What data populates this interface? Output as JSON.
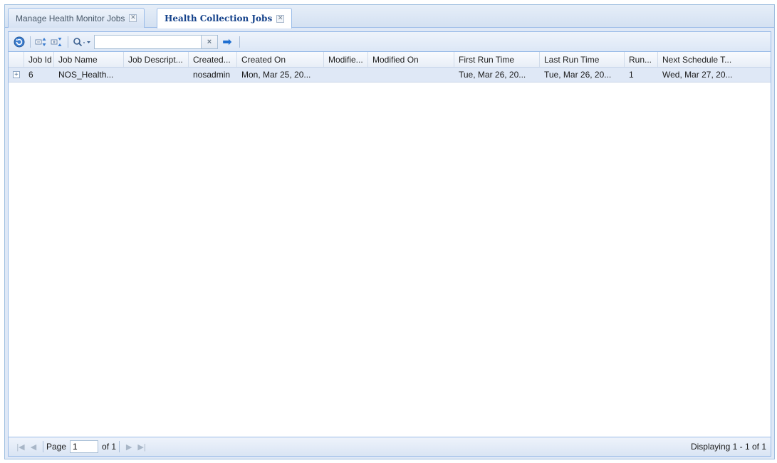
{
  "tabs": [
    {
      "label": "Manage Health Monitor Jobs",
      "close": "✕"
    },
    {
      "label": "Health Collection Jobs",
      "close": "✕"
    }
  ],
  "toolbar": {
    "search_placeholder": "",
    "search_value": "",
    "clear_glyph": "×",
    "go_glyph": "➡",
    "refresh_icon": "refresh-icon",
    "expand_all_icon": "expand-all-icon",
    "collapse_all_icon": "collapse-all-icon",
    "search_menu_glyph": "Q▾"
  },
  "grid": {
    "columns": [
      "Job Id",
      "Job Name",
      "Job Descript...",
      "Created...",
      "Created On",
      "Modifie...",
      "Modified On",
      "First Run Time",
      "Last Run Time",
      "Run...",
      "Next Schedule T..."
    ],
    "rows": [
      {
        "expander": "+",
        "cells": [
          "6",
          "NOS_Health...",
          "",
          "nosadmin",
          "Mon, Mar 25, 20...",
          "",
          "",
          "Tue, Mar 26, 20...",
          "Tue, Mar 26, 20...",
          "1",
          "Wed, Mar 27, 20..."
        ]
      }
    ]
  },
  "paging": {
    "page_label": "Page",
    "page_value": "1",
    "of_label": "of 1",
    "display_info": "Displaying 1 - 1 of 1"
  }
}
